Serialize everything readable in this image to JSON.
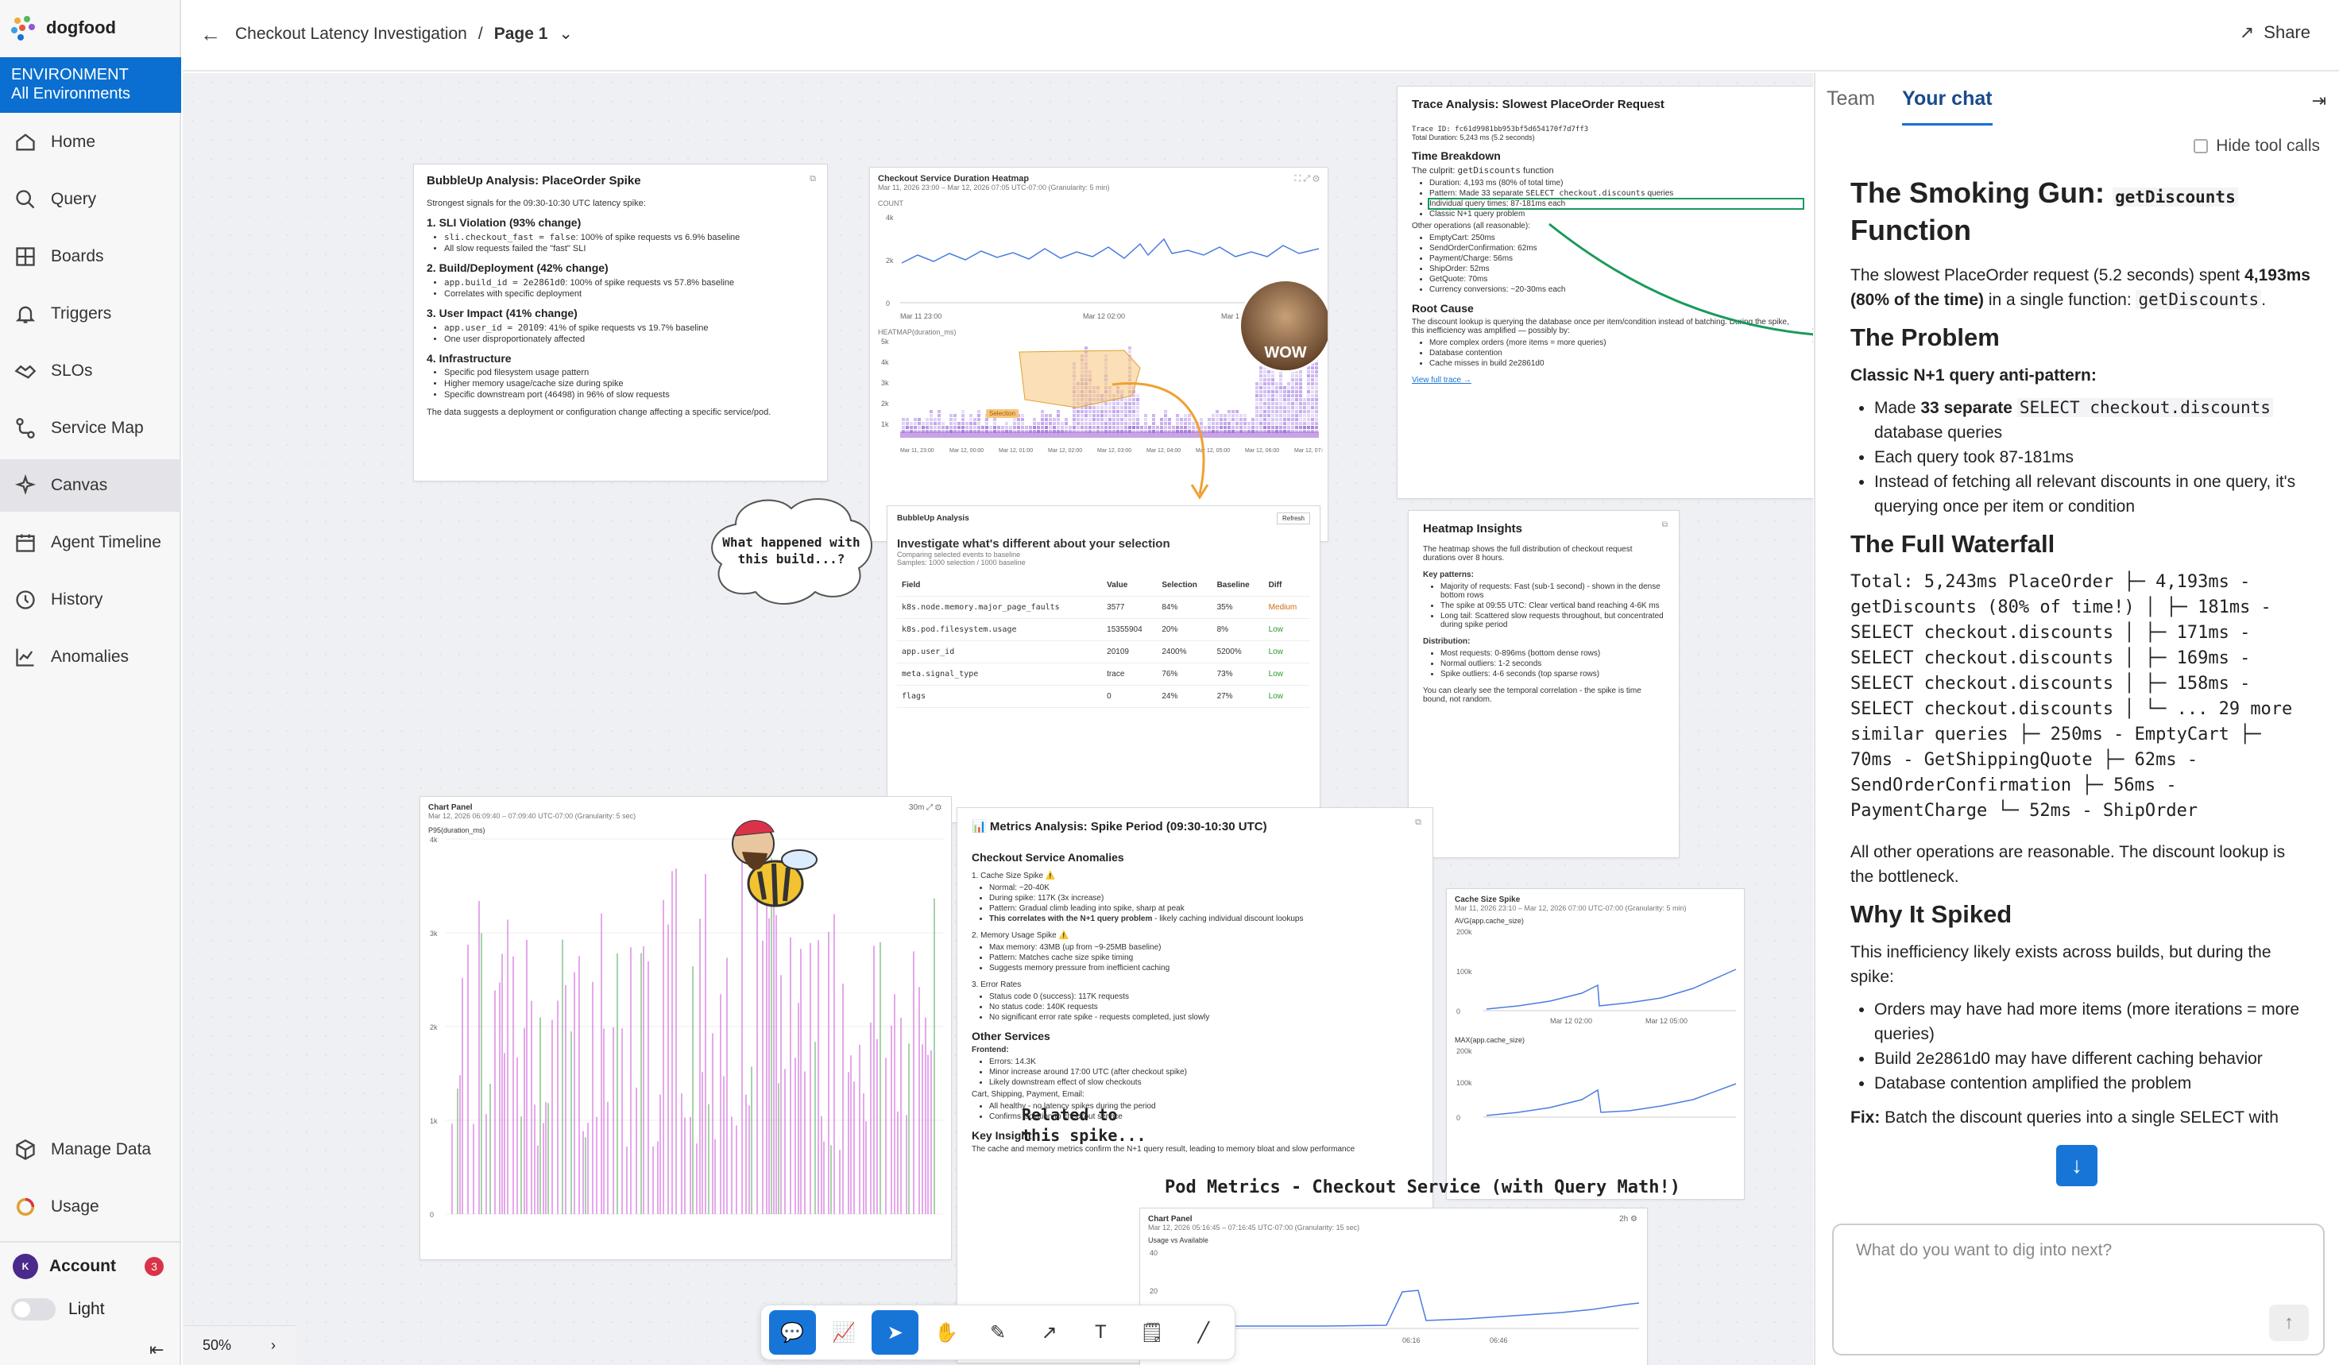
{
  "app": {
    "name": "dogfood"
  },
  "environment": {
    "label": "ENVIRONMENT",
    "value": "All Environments"
  },
  "nav": [
    "Home",
    "Query",
    "Boards",
    "Triggers",
    "SLOs",
    "Service Map",
    "Canvas",
    "Agent Timeline",
    "History",
    "Anomalies"
  ],
  "bottom_nav": [
    "Manage Data",
    "Usage"
  ],
  "account": {
    "label": "Account",
    "initial": "K",
    "badge": "3"
  },
  "theme": {
    "label": "Light"
  },
  "header": {
    "title": "Checkout Latency Investigation",
    "separator": "/",
    "page": "Page 1",
    "share": "Share"
  },
  "zoom": {
    "level": "50%"
  },
  "colors": {
    "accent": "#1875d8",
    "env_bg": "#0a6fd0",
    "arrow_green": "#1a9a5a",
    "arrow_orange": "#f0a030",
    "heatmap_selection": "#f7c57a"
  },
  "bubbleup1": {
    "title": "BubbleUp Analysis: PlaceOrder Spike",
    "intro": "Strongest signals for the 09:30-10:30 UTC latency spike:",
    "s1": "1. SLI Violation (93% change)",
    "s1a_code": "sli.checkout_fast = false",
    "s1a": ": 100% of spike requests vs 6.9% baseline",
    "s1b": "All slow requests failed the \"fast\" SLI",
    "s2": "2. Build/Deployment (42% change)",
    "s2a_code": "app.build_id = 2e2861d0",
    "s2a": ": 100% of spike requests vs 57.8% baseline",
    "s2b": "Correlates with specific deployment",
    "s3": "3. User Impact (41% change)",
    "s3a_code": "app.user_id = 20109",
    "s3a": ": 41% of spike requests vs 19.7% baseline",
    "s3b": "One user disproportionately affected",
    "s4": "4. Infrastructure",
    "s4a": "Specific pod filesystem usage pattern",
    "s4b": "Higher memory usage/cache size during spike",
    "s4c": "Specific downstream port (46498) in 96% of slow requests",
    "footer": "The data suggests a deployment or configuration change affecting a specific service/pod."
  },
  "heatmap_card": {
    "title": "Checkout Service Duration Heatmap",
    "subtitle": "Mar 11, 2026 23:00 – Mar 12, 2026 07:05 UTC-07:00 (Granularity: 5 min)",
    "count_label": "COUNT",
    "count_ticks": [
      "4k",
      "2k",
      "0"
    ],
    "count_x_ticks": [
      "Mar 11 23:00",
      "Mar 12 02:00",
      "Mar 12 05:00"
    ],
    "heatmap_label": "HEATMAP(duration_ms)",
    "selection_tag": "Selection",
    "heat_ticks": [
      "5k",
      "4k",
      "3k",
      "2k",
      "1k"
    ],
    "heat_x_ticks": [
      "Mar 11, 23:00",
      "Mar 12, 00:00",
      "Mar 12, 01:00",
      "Mar 12, 02:00",
      "Mar 12, 03:00",
      "Mar 12, 04:00",
      "Mar 12, 05:00",
      "Mar 12, 06:00",
      "Mar 12, 07:00"
    ],
    "sticker": "WOW"
  },
  "trace_card": {
    "title": "Trace Analysis: Slowest PlaceOrder Request",
    "trace_id": "Trace ID:  fc61d9981bb953bf5d654170f7d7ff3",
    "total": "Total Duration: 5,243 ms (5.2 seconds)",
    "tb": "Time Breakdown",
    "culprit_pre": "The culprit:",
    "culprit_code": "getDiscounts",
    "culprit_post": "function",
    "b1": "Duration: 4,193 ms (80% of total time)",
    "b2_pre": "Pattern: Made 33 separate",
    "b2_code": "SELECT checkout.discounts",
    "b2_post": "queries",
    "b3": "Individual query times: 87-181ms each",
    "b4": "Classic N+1 query problem",
    "other": "Other operations (all reasonable):",
    "ops": [
      "EmptyCart: 250ms",
      "SendOrderConfirmation: 62ms",
      "Payment/Charge: 56ms",
      "ShipOrder: 52ms",
      "GetQuote: 70ms",
      "Currency conversions: ~20-30ms each"
    ],
    "rc": "Root Cause",
    "rc_text": "The discount lookup is querying the database once per item/condition instead of batching. During the spike, this inefficiency was amplified — possibly by:",
    "rc_items": [
      "More complex orders (more items = more queries)",
      "Database contention",
      "Cache misses in build 2e2861d0"
    ],
    "link": "View full trace →"
  },
  "bubbleup2": {
    "title": "BubbleUp Analysis",
    "refresh": "Refresh",
    "heading": "Investigate what's different about your selection",
    "sub1": "Comparing selected events to baseline",
    "sub2": "Samples: 1000 selection / 1000 baseline",
    "cols": [
      "Field",
      "Value",
      "Selection",
      "Baseline",
      "Diff"
    ],
    "rows": [
      {
        "field": "k8s.node.memory.major_page_faults",
        "value": "3577",
        "sel": "84%",
        "base": "35%",
        "diff": "Medium"
      },
      {
        "field": "k8s.pod.filesystem.usage",
        "value": "15355904",
        "sel": "20%",
        "base": "8%",
        "diff": "Low"
      },
      {
        "field": "app.user_id",
        "value": "20109",
        "sel": "2400%",
        "base": "5200%",
        "diff": "Low"
      },
      {
        "field": "meta.signal_type",
        "value": "trace",
        "sel": "76%",
        "base": "73%",
        "diff": "Low"
      },
      {
        "field": "flags",
        "value": "0",
        "sel": "24%",
        "base": "27%",
        "diff": "Low"
      }
    ]
  },
  "cloud_note": "What happened with this build...?",
  "insights": {
    "title": "Heatmap Insights",
    "intro": "The heatmap shows the full distribution of checkout request durations over 8 hours.",
    "kp": "Key patterns:",
    "k1": "Majority of requests: Fast (sub-1 second) - shown in the dense bottom rows",
    "k2": "The spike at 09:55 UTC: Clear vertical band reaching 4-6K ms",
    "k3": "Long tail: Scattered slow requests throughout, but concentrated during spike period",
    "dist": "Distribution:",
    "d1": "Most requests: 0-896ms (bottom dense rows)",
    "d2": "Normal outliers: 1-2 seconds",
    "d3": "Spike outliers: 4-6 seconds (top sparse rows)",
    "footer": "You can clearly see the temporal correlation - the spike is time bound, not random."
  },
  "chart_panel": {
    "title": "Chart Panel",
    "subtitle": "Mar 12, 2026 06:09:40 – 07:09:40 UTC-07:00 (Granularity: 5 sec)",
    "range": "30m",
    "metric": "P95(duration_ms)",
    "yticks": [
      "4k",
      "3k",
      "2k",
      "1k",
      "0"
    ]
  },
  "metrics": {
    "title": "📊 Metrics Analysis: Spike Period (09:30-10:30 UTC)",
    "h1": "Checkout Service Anomalies",
    "c1": "1. Cache Size Spike ⚠️",
    "c1a": "Normal: ~20-40K",
    "c1b": "During spike: 117K (3x increase)",
    "c1c": "Pattern: Gradual climb leading into spike, sharp at peak",
    "c1d": "This correlates with the N+1 query problem",
    "c1d2": " - likely caching individual discount lookups",
    "c2": "2. Memory Usage Spike ⚠️",
    "c2a": "Max memory: 43MB (up from ~9-25MB baseline)",
    "c2b": "Pattern: Matches cache size spike timing",
    "c2c": "Suggests memory pressure from inefficient caching",
    "c3": "3. Error Rates",
    "c3a": "Status code 0 (success): 117K requests",
    "c3b": "No status code: 140K requests",
    "c3c": "No significant error rate spike - requests completed, just slowly",
    "h2": "Other Services",
    "fe": "Frontend:",
    "fe1": "Errors: 14.3K",
    "fe2": "Minor increase around 17:00 UTC (after checkout spike)",
    "fe3": "Likely downstream effect of slow checkouts",
    "csp": "Cart, Shipping, Payment, Email:",
    "csp1": "All healthy - no latency spikes during the period",
    "csp2": "Confirms isolation to checkout service",
    "h3": "Key Insight",
    "ki": "The cache and memory metrics confirm the N+1 query result, leading to memory bloat and slow performance"
  },
  "related_note": "Related to this spike...",
  "cache_card": {
    "title": "Cache Size Spike",
    "subtitle": "Mar 11, 2026 23:10 – Mar 12, 2026 07:00 UTC-07:00 (Granularity: 5 min)",
    "m1": "AVG(app.cache_size)",
    "m1_ticks": [
      "200k",
      "100k",
      "0"
    ],
    "x_ticks": [
      "Mar 12 02:00",
      "Mar 12 05:00"
    ],
    "m2": "MAX(app.cache_size)",
    "m2_ticks": [
      "200k",
      "100k",
      "0"
    ]
  },
  "pod_note": "Pod Metrics - Checkout Service (with Query Math!)",
  "pod_card": {
    "title": "Chart Panel",
    "subtitle": "Mar 12, 2026 05:16:45 – 07:16:45 UTC-07:00 (Granularity: 15 sec)",
    "range": "2h",
    "metric": "Usage vs Available",
    "yticks": [
      "40",
      "20",
      "0"
    ],
    "xticks": [
      "06:16",
      "06:46"
    ]
  },
  "chat": {
    "tabs": [
      "Team",
      "Your chat"
    ],
    "hide_tool": "Hide tool calls",
    "h1_pre": "The Smoking Gun: ",
    "h1_code": "getDiscounts",
    "h1_post": "Function",
    "p1_pre": "The slowest PlaceOrder request (5.2 seconds) spent ",
    "p1_bold": "4,193ms (80% of the time)",
    "p1_post": " in a single function: ",
    "p1_code": "getDiscounts",
    "p1_end": ".",
    "h_problem": "The Problem",
    "problem_bold": "Classic N+1 query anti-pattern:",
    "pr1_pre": "Made ",
    "pr1_bold": "33 separate",
    "pr1_code": "SELECT checkout.discounts",
    "pr1_post": " database queries",
    "pr2": "Each query took 87-181ms",
    "pr3": "Instead of fetching all relevant discounts in one query, it's querying once per item or condition",
    "h_waterfall": "The Full Waterfall",
    "waterfall": "Total: 5,243ms PlaceOrder ├─ 4,193ms - getDiscounts (80% of time!) │ ├─ 181ms - SELECT checkout.discounts │ ├─ 171ms - SELECT checkout.discounts │ ├─ 169ms - SELECT checkout.discounts │ ├─ 158ms - SELECT checkout.discounts │ └─ ... 29 more similar queries ├─ 250ms - EmptyCart ├─ 70ms - GetShippingQuote ├─ 62ms - SendOrderConfirmation ├─ 56ms - PaymentCharge └─ 52ms - ShipOrder",
    "p_other": "All other operations are reasonable. The discount lookup is the bottleneck.",
    "h_why": "Why It Spiked",
    "why": "This inefficiency likely exists across builds, but during the spike:",
    "w1": "Orders may have had more items (more iterations = more queries)",
    "w2": "Build 2e2861d0 may have different caching behavior",
    "w3": "Database contention amplified the problem",
    "fix_bold": "Fix:",
    "fix": " Batch the discount queries into a single SELECT with",
    "input_placeholder": "What do you want to dig into next?"
  }
}
